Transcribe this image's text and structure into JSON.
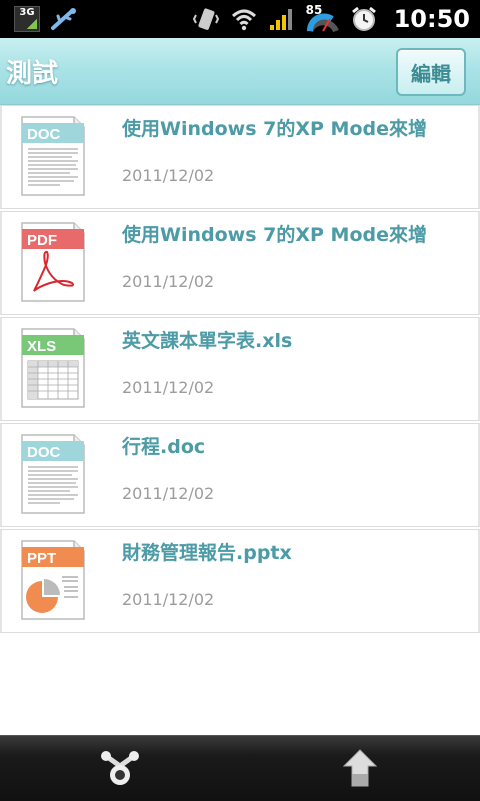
{
  "status_bar": {
    "network": "3G",
    "battery_level": "85",
    "time": "10:50",
    "icons": [
      "3g-icon",
      "usb-icon",
      "vibrate-icon",
      "wifi-icon",
      "signal-icon",
      "battery-icon",
      "alarm-icon"
    ]
  },
  "header": {
    "title": "測試",
    "edit_label": "編輯"
  },
  "files": [
    {
      "name": "使用Windows 7的XP Mode來增",
      "date": "2011/12/02",
      "type": "DOC",
      "icon": "doc-file-icon"
    },
    {
      "name": "使用Windows 7的XP Mode來增",
      "date": "2011/12/02",
      "type": "PDF",
      "icon": "pdf-file-icon"
    },
    {
      "name": "英文課本單字表.xls",
      "date": "2011/12/02",
      "type": "XLS",
      "icon": "xls-file-icon"
    },
    {
      "name": "行程.doc",
      "date": "2011/12/02",
      "type": "DOC",
      "icon": "doc-file-icon"
    },
    {
      "name": "財務管理報告.pptx",
      "date": "2011/12/02",
      "type": "PPT",
      "icon": "ppt-file-icon"
    }
  ],
  "bottom_bar": {
    "left_icon": "share-icon",
    "right_icon": "upload-icon"
  },
  "colors": {
    "header_bg": "#a8e2e6",
    "title_text": "#ffffff",
    "file_name": "#4c9ba6",
    "date_text": "#9c9c9c",
    "doc_badge": "#9fd6dc",
    "pdf_badge": "#e86a6a",
    "xls_badge": "#78c878",
    "ppt_badge": "#f08c50"
  }
}
